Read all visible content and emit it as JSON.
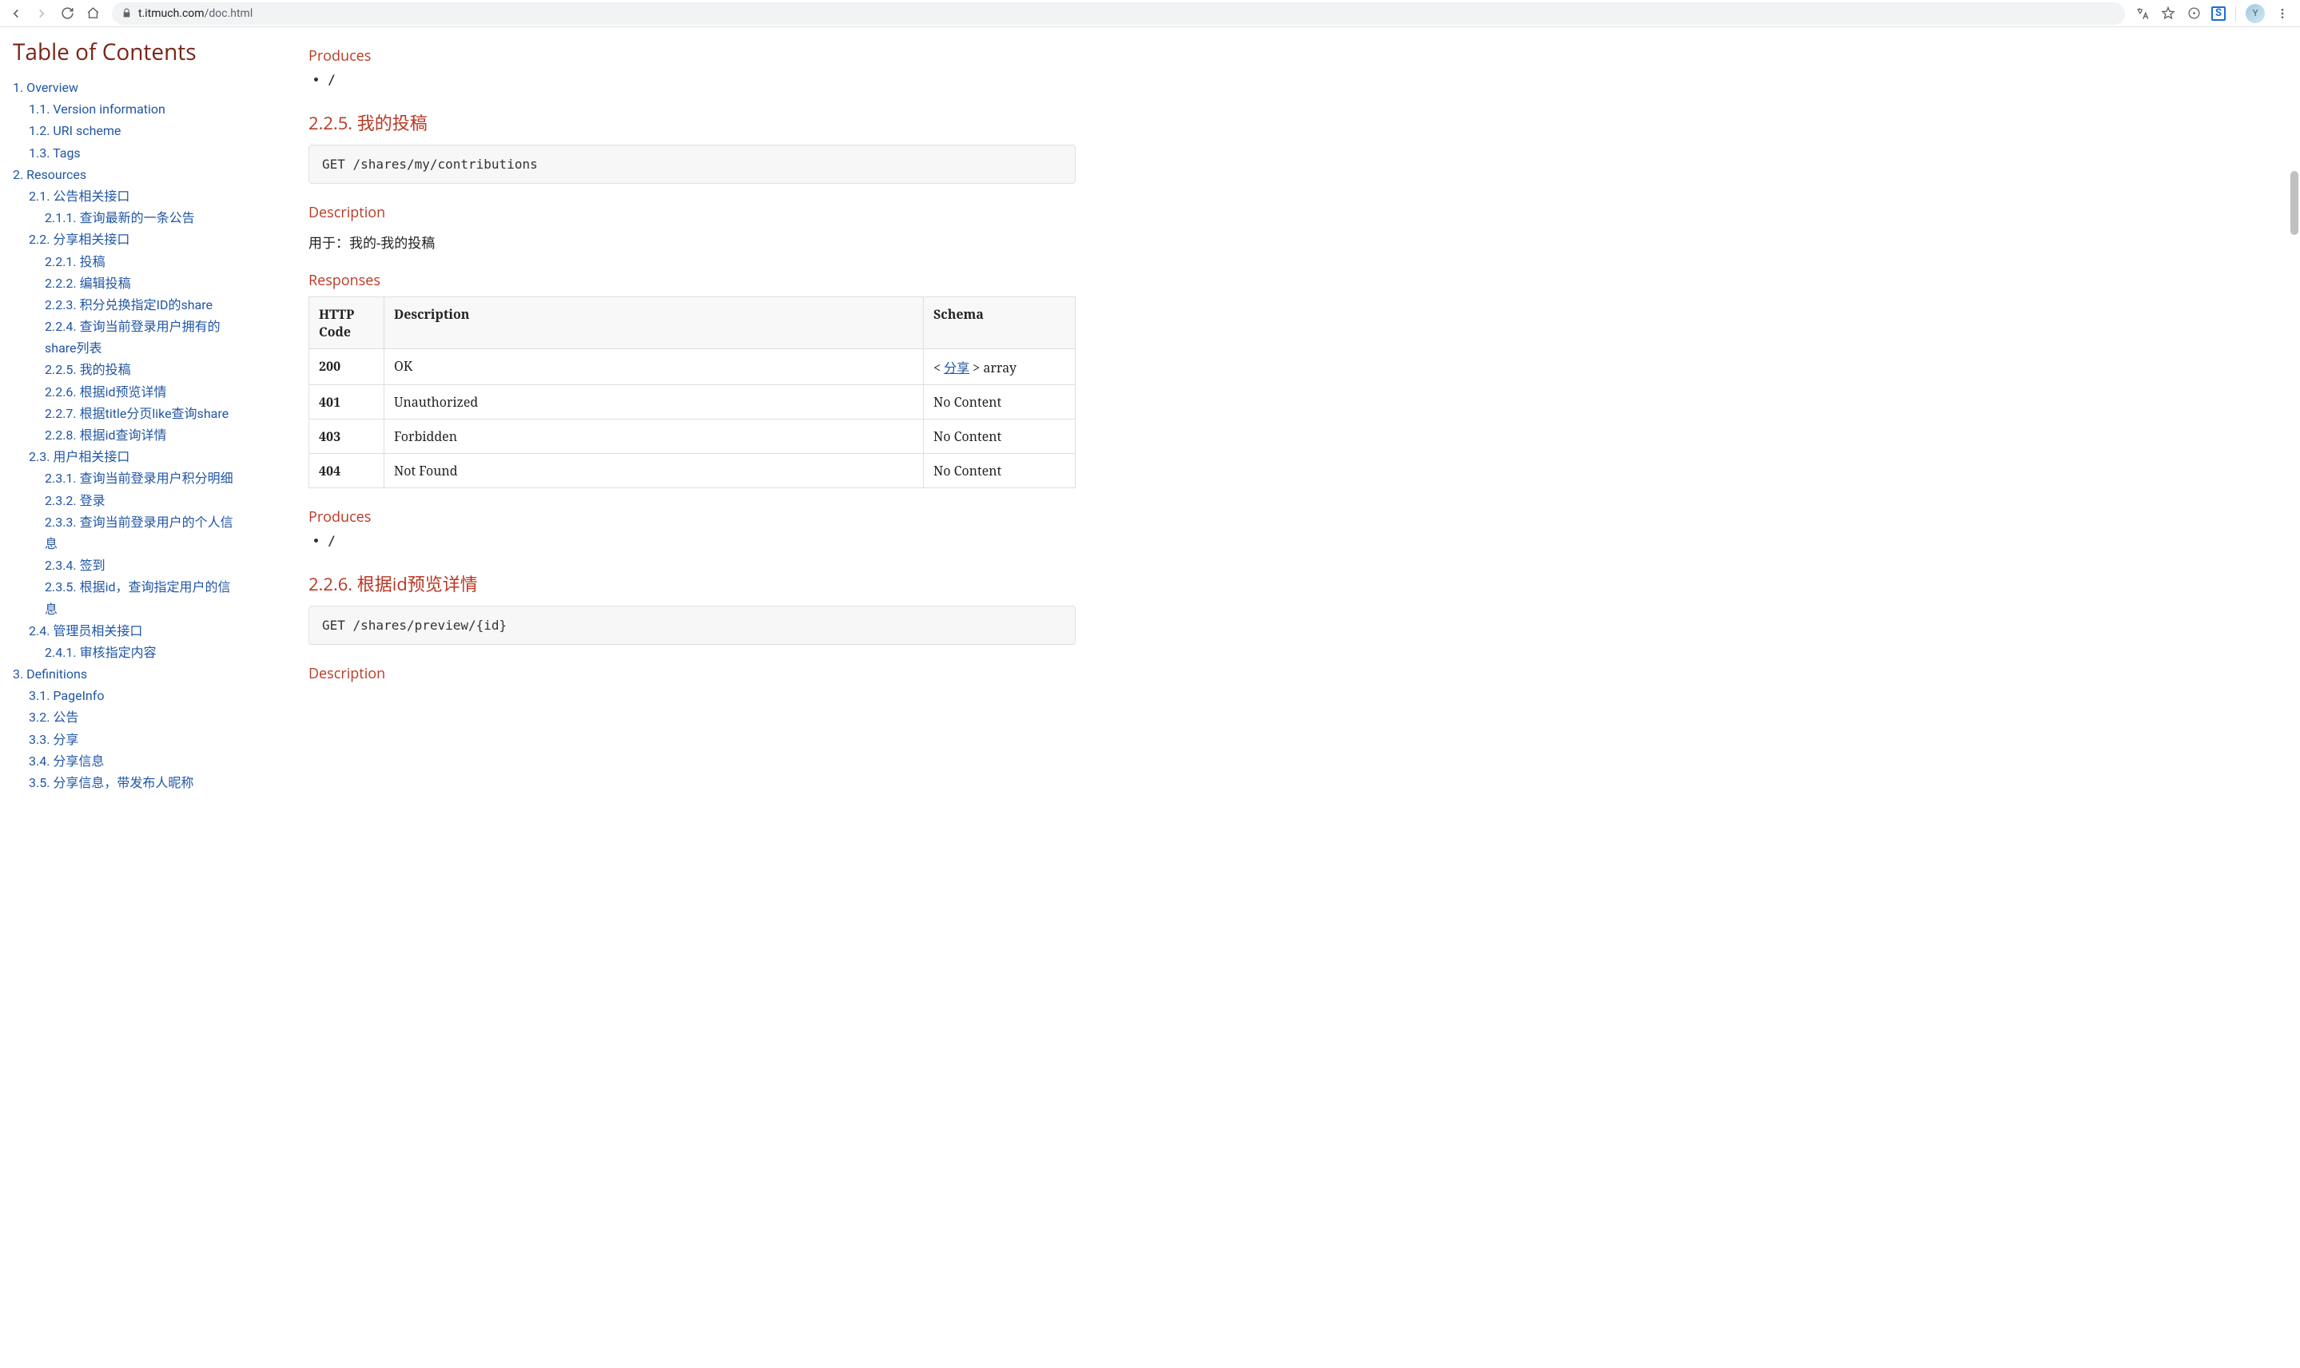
{
  "browser": {
    "url_domain": "t.itmuch.com",
    "url_path": "/doc.html"
  },
  "toc": {
    "title": "Table of Contents",
    "items": [
      {
        "level": 1,
        "label": "1. Overview"
      },
      {
        "level": 2,
        "label": "1.1. Version information"
      },
      {
        "level": 2,
        "label": "1.2. URI scheme"
      },
      {
        "level": 2,
        "label": "1.3. Tags"
      },
      {
        "level": 1,
        "label": "2. Resources"
      },
      {
        "level": 2,
        "label": "2.1. 公告相关接口"
      },
      {
        "level": 3,
        "label": "2.1.1. 查询最新的一条公告"
      },
      {
        "level": 2,
        "label": "2.2. 分享相关接口"
      },
      {
        "level": 3,
        "label": "2.2.1. 投稿"
      },
      {
        "level": 3,
        "label": "2.2.2. 编辑投稿"
      },
      {
        "level": 3,
        "label": "2.2.3. 积分兑换指定ID的share"
      },
      {
        "level": 3,
        "label": "2.2.4. 查询当前登录用户拥有的share列表"
      },
      {
        "level": 3,
        "label": "2.2.5. 我的投稿"
      },
      {
        "level": 3,
        "label": "2.2.6. 根据id预览详情"
      },
      {
        "level": 3,
        "label": "2.2.7. 根据title分页like查询share"
      },
      {
        "level": 3,
        "label": "2.2.8. 根据id查询详情"
      },
      {
        "level": 2,
        "label": "2.3. 用户相关接口"
      },
      {
        "level": 3,
        "label": "2.3.1. 查询当前登录用户积分明细"
      },
      {
        "level": 3,
        "label": "2.3.2. 登录"
      },
      {
        "level": 3,
        "label": "2.3.3. 查询当前登录用户的个人信息"
      },
      {
        "level": 3,
        "label": "2.3.4. 签到"
      },
      {
        "level": 3,
        "label": "2.3.5. 根据id，查询指定用户的信息"
      },
      {
        "level": 2,
        "label": "2.4. 管理员相关接口"
      },
      {
        "level": 3,
        "label": "2.4.1. 审核指定内容"
      },
      {
        "level": 1,
        "label": "3. Definitions"
      },
      {
        "level": 2,
        "label": "3.1. PageInfo"
      },
      {
        "level": 2,
        "label": "3.2. 公告"
      },
      {
        "level": 2,
        "label": "3.3. 分享"
      },
      {
        "level": 2,
        "label": "3.4. 分享信息"
      },
      {
        "level": 2,
        "label": "3.5. 分享信息，带发布人昵称"
      }
    ]
  },
  "content": {
    "sec0_produces_heading": "Produces",
    "sec0_produces_item": "/",
    "sec225_heading": "2.2.5. 我的投稿",
    "sec225_code": "GET /shares/my/contributions",
    "sec225_desc_heading": "Description",
    "sec225_desc_text": "用于：我的-我的投稿",
    "sec225_resp_heading": "Responses",
    "table": {
      "th_code": "HTTP Code",
      "th_desc": "Description",
      "th_schema": "Schema",
      "rows": [
        {
          "code": "200",
          "desc": "OK",
          "schema_prefix": "< ",
          "schema_link": "分享",
          "schema_suffix": " > array"
        },
        {
          "code": "401",
          "desc": "Unauthorized",
          "schema": "No Content"
        },
        {
          "code": "403",
          "desc": "Forbidden",
          "schema": "No Content"
        },
        {
          "code": "404",
          "desc": "Not Found",
          "schema": "No Content"
        }
      ]
    },
    "sec225_produces_heading": "Produces",
    "sec225_produces_item": "/",
    "sec226_heading": "2.2.6. 根据id预览详情",
    "sec226_code": "GET /shares/preview/{id}",
    "sec226_desc_heading": "Description"
  }
}
